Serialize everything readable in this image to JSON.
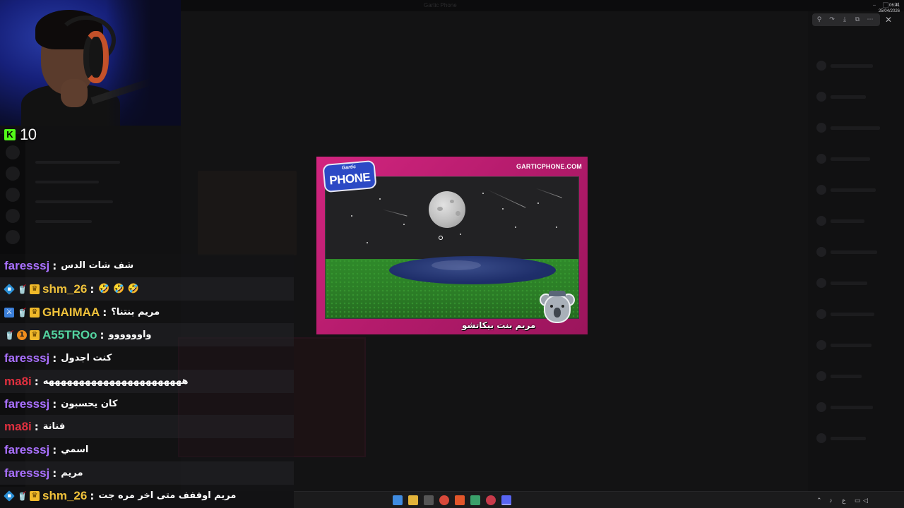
{
  "window": {
    "title": "Gartic Phone"
  },
  "stream": {
    "viewer_count": "10"
  },
  "gartic": {
    "site": "GARTICPHONE.COM",
    "logo_small": "Gartic",
    "logo_big": "PHONE",
    "caption": "مريم بنت بيكاتشو"
  },
  "chat": {
    "separator": ":",
    "messages": [
      {
        "username": "faresssj",
        "color": "#a970ff",
        "badges": [],
        "text": "شف شات الدس"
      },
      {
        "username": "shm_26",
        "color": "#f0c23b",
        "badges": [
          "sub",
          "cup",
          "crown"
        ],
        "text": "🤣 🤣 🤣"
      },
      {
        "username": "GHAIMAA",
        "color": "#f0c23b",
        "badges": [
          "vip",
          "cup",
          "crown"
        ],
        "text": "مريم بنتنا؟"
      },
      {
        "username": "A55TROo",
        "color": "#53d4a0",
        "badges": [
          "cup",
          "one",
          "crown"
        ],
        "text": "واوووووو"
      },
      {
        "username": "faresssj",
        "color": "#a970ff",
        "badges": [],
        "text": "كنت اجدول"
      },
      {
        "username": "ma8i",
        "color": "#e0303f",
        "badges": [],
        "text": "هههههههههههههههههههههههه"
      },
      {
        "username": "faresssj",
        "color": "#a970ff",
        "badges": [],
        "text": "كان يحسبون"
      },
      {
        "username": "ma8i",
        "color": "#e0303f",
        "badges": [],
        "text": "فنانة"
      },
      {
        "username": "faresssj",
        "color": "#a970ff",
        "badges": [],
        "text": "اسمي"
      },
      {
        "username": "faresssj",
        "color": "#a970ff",
        "badges": [],
        "text": "مريم"
      },
      {
        "username": "shm_26",
        "color": "#f0c23b",
        "badges": [
          "sub",
          "cup",
          "crown"
        ],
        "text": "مريم اوففف متى اخر مره جت"
      }
    ]
  },
  "taskbar": {
    "lang": "ع",
    "time": "06:41",
    "date": "25/04/2026"
  },
  "icons": {
    "kick": "kick-logo-icon",
    "viewer_tools": [
      "zoom-icon",
      "rotate-icon",
      "download-icon",
      "external-link-icon",
      "more-icon"
    ],
    "close": "close-icon"
  }
}
